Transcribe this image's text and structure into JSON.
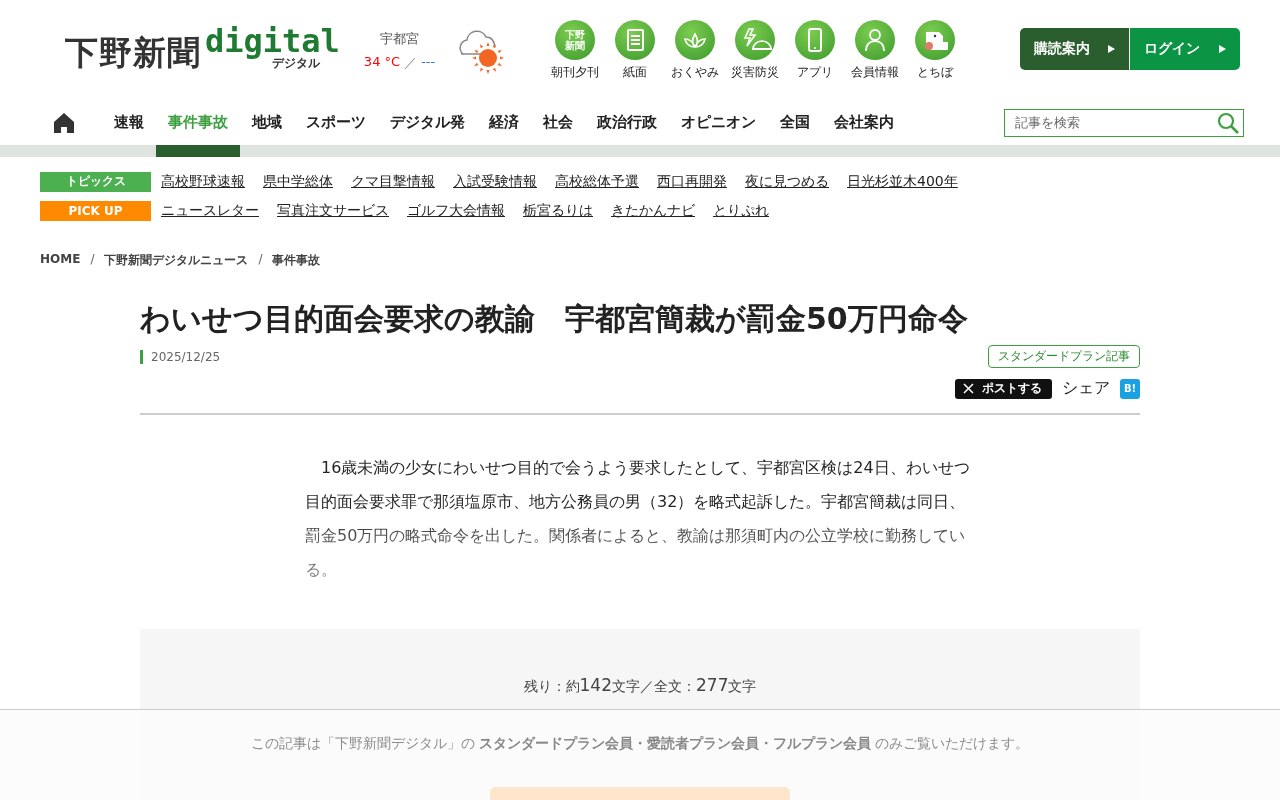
{
  "logo": {
    "name": "下野新聞",
    "brand": "digital",
    "sub": "デジタル"
  },
  "weather": {
    "city": "宇都宮",
    "high": "34 °C",
    "separator": "／",
    "low": "---"
  },
  "services": [
    {
      "kind": "paper",
      "label": "朝刊夕刊",
      "icon_text": "下野新聞"
    },
    {
      "kind": "document",
      "label": "紙面"
    },
    {
      "kind": "lotus",
      "label": "おくやみ"
    },
    {
      "kind": "disaster",
      "label": "災害防災"
    },
    {
      "kind": "phone",
      "label": "アプリ"
    },
    {
      "kind": "person",
      "label": "会員情報"
    },
    {
      "kind": "mascot",
      "label": "とちぼ"
    }
  ],
  "account_buttons": [
    {
      "label": "購読案内",
      "kind": "subscribe"
    },
    {
      "label": "ログイン",
      "kind": "login"
    }
  ],
  "nav": {
    "items": [
      {
        "label": "速報",
        "selected": false
      },
      {
        "label": "事件事故",
        "selected": true
      },
      {
        "label": "地域",
        "selected": false
      },
      {
        "label": "スポーツ",
        "selected": false
      },
      {
        "label": "デジタル発",
        "selected": false
      },
      {
        "label": "経済",
        "selected": false
      },
      {
        "label": "社会",
        "selected": false
      },
      {
        "label": "政治行政",
        "selected": false
      },
      {
        "label": "オピニオン",
        "selected": false
      },
      {
        "label": "全国",
        "selected": false
      },
      {
        "label": "会社案内",
        "selected": false
      }
    ],
    "search": {
      "placeholder": "記事を検索"
    }
  },
  "topic_rows": [
    {
      "label": "トピックス",
      "color": "#4caf50",
      "links": [
        "高校野球速報",
        "県中学総体",
        "クマ目撃情報",
        "入試受験情報",
        "高校総体予選",
        "西口再開発",
        "夜に見つめる",
        "日光杉並木400年"
      ]
    },
    {
      "label": "PICK UP",
      "color": "#ff8a00",
      "links": [
        "ニュースレター",
        "写真注文サービス",
        "ゴルフ大会情報",
        "栃宮るりは",
        "きたかんナビ",
        "とりぷれ"
      ]
    }
  ],
  "breadcrumb": {
    "separator": "/",
    "items": [
      "HOME",
      "下野新聞デジタルニュース",
      "事件事故"
    ]
  },
  "article": {
    "title": "わいせつ目的面会要求の教諭　宇都宮簡裁が罰金50万円命令",
    "date": "2025/12/25",
    "plan_tag": "スタンダードプラン記事",
    "share": {
      "post": "ポストする",
      "label": "シェア",
      "bookmark": "B!"
    },
    "body": "　16歳未満の少女にわいせつ目的で会うよう要求したとして、宇都宮区検は24日、わいせつ目的面会要求罪で那須塩原市、地方公務員の男（32）を略式起訴した。宇都宮簡裁は同日、罰金50万円の略式命令を出した。関係者によると、教諭は那須町内の公立学校に勤務している。"
  },
  "paywall": {
    "count": [
      {
        "kind": "label",
        "text": "残り：約"
      },
      {
        "kind": "number",
        "text": "142"
      },
      {
        "kind": "label",
        "text": "文字／全文："
      },
      {
        "kind": "number",
        "text": "277"
      },
      {
        "kind": "label",
        "text": "文字"
      }
    ],
    "notice": "この記事は「下野新聞デジタル」の **スタンダードプラン会員・愛読者プラン会員・フルプラン会員** のみご覧いただけます。"
  }
}
